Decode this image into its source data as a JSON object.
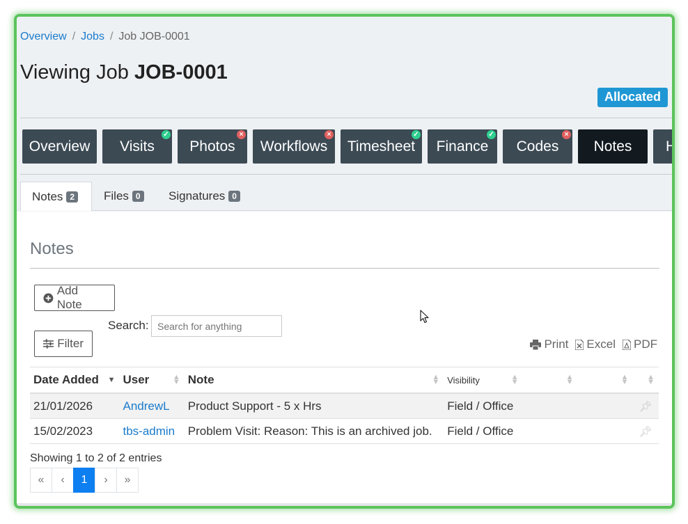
{
  "breadcrumb": {
    "items": [
      "Overview",
      "Jobs"
    ],
    "current": "Job JOB-0001",
    "sep": "/"
  },
  "header": {
    "title_prefix": "Viewing Job",
    "job_id": "JOB-0001",
    "status": "Allocated"
  },
  "nav": {
    "buttons": [
      {
        "label": "Overview",
        "status": ""
      },
      {
        "label": "Visits",
        "status": "ok"
      },
      {
        "label": "Photos",
        "status": "error"
      },
      {
        "label": "Workflows",
        "status": "error"
      },
      {
        "label": "Timesheet",
        "status": "ok"
      },
      {
        "label": "Finance",
        "status": "ok"
      },
      {
        "label": "Codes",
        "status": "error"
      },
      {
        "label": "Notes",
        "status": ""
      },
      {
        "label": "H",
        "status": ""
      }
    ]
  },
  "tabs": [
    {
      "label": "Notes",
      "count": "2"
    },
    {
      "label": "Files",
      "count": "0"
    },
    {
      "label": "Signatures",
      "count": "0"
    }
  ],
  "section": {
    "title": "Notes"
  },
  "toolbar": {
    "add_note": "Add Note",
    "filter": "Filter",
    "search_label": "Search:",
    "search_placeholder": "Search for anything",
    "print": "Print",
    "excel": "Excel",
    "pdf": "PDF"
  },
  "table": {
    "headers": [
      "Date Added",
      "User",
      "Note",
      "Visibility"
    ],
    "rows": [
      {
        "date": "21/01/2026",
        "user": "AndrewL",
        "note": "Product Support - 5 x Hrs",
        "visibility": "Field / Office"
      },
      {
        "date": "15/02/2023",
        "user": "tbs-admin",
        "note": "Problem Visit: Reason: This is an archived job.",
        "visibility": "Field / Office"
      }
    ]
  },
  "footer": {
    "info": "Showing 1 to 2 of 2 entries"
  },
  "pagination": {
    "first": "«",
    "prev": "‹",
    "current": "1",
    "next": "›",
    "last": "»"
  },
  "colors": {
    "accent": "#1a7bcc",
    "status_badge": "#1f97d4",
    "nav_bg": "#3c4a54",
    "ok": "#2fcf8f",
    "error": "#e06060",
    "frame": "#5cc45c"
  }
}
